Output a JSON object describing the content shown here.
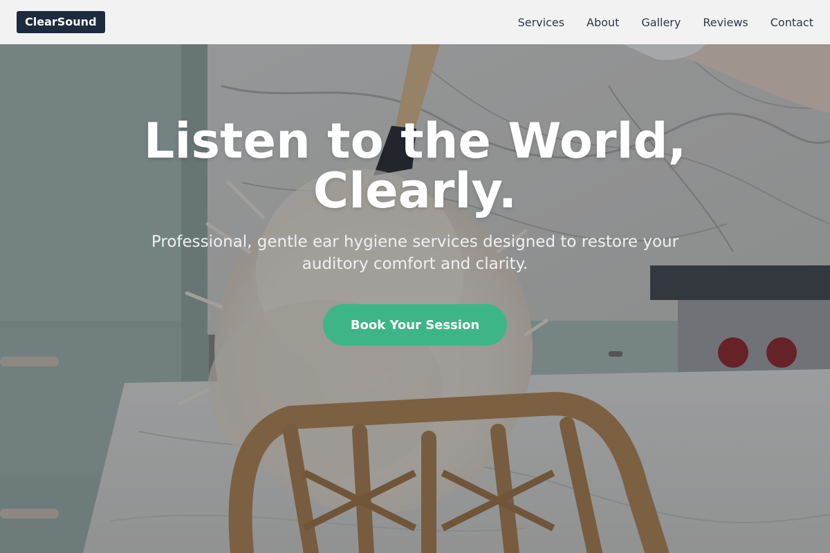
{
  "header": {
    "logo": "ClearSound",
    "nav": [
      "Services",
      "About",
      "Gallery",
      "Reviews",
      "Contact"
    ]
  },
  "hero": {
    "title": "Listen to the World, Clearly.",
    "subtitle": "Professional, gentle ear hygiene services designed to restore your auditory comfort and clarity.",
    "cta_label": "Book Your Session"
  },
  "colors": {
    "brand_dark": "#1e2a3d",
    "accent_green": "#3db586"
  }
}
